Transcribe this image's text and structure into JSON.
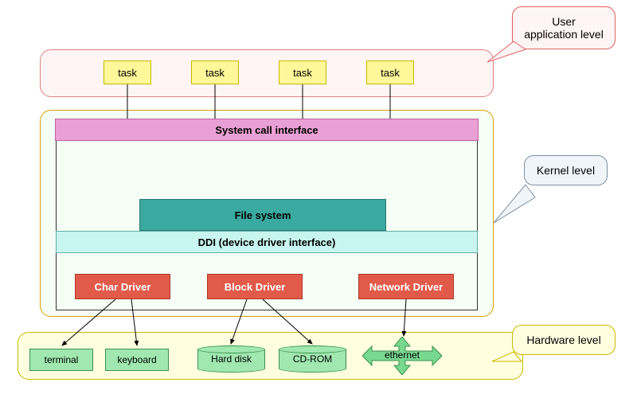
{
  "tasks": {
    "t1": "task",
    "t2": "task",
    "t3": "task",
    "t4": "task"
  },
  "syscall": "System call interface",
  "filesystem": "File system",
  "ddi": "DDI (device driver interface)",
  "drivers": {
    "char": "Char Driver",
    "block": "Block Driver",
    "network": "Network Driver"
  },
  "hardware": {
    "terminal": "terminal",
    "keyboard": "keyboard",
    "harddisk": "Hard disk",
    "cdrom": "CD-ROM",
    "ethernet": "ethernet"
  },
  "callouts": {
    "user": "User application level",
    "kernel": "Kernel level",
    "hw": "Hardware level"
  },
  "colors": {
    "task_bg": "#fff79a",
    "driver_bg": "#e25a4a",
    "hw_bg": "#a0e8b0",
    "syscall_bg": "#e9a0d4",
    "ddi_bg": "#c8f5ef",
    "fs_bg": "#3aa9a0"
  }
}
